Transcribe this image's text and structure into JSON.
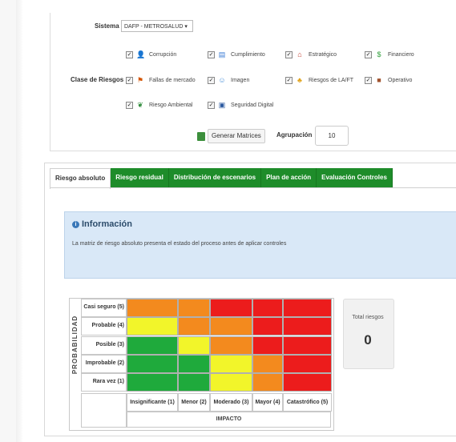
{
  "filters": {
    "system_label": "Sistema",
    "system_value": "DAFP - METROSALUD ▾",
    "risk_class_label": "Clase de Riesgos",
    "risk_classes": [
      {
        "label": "Corrupción",
        "icon": "lock-person-icon",
        "color": "#e88a1a",
        "checked": true
      },
      {
        "label": "Cumplimiento",
        "icon": "clipboard-icon",
        "color": "#3a7bd5",
        "checked": true
      },
      {
        "label": "Estratégico",
        "icon": "house-icon",
        "color": "#c0392b",
        "checked": true
      },
      {
        "label": "Financiero",
        "icon": "dollar-icon",
        "color": "#2e9e3a",
        "checked": true
      },
      {
        "label": "Fallas de mercado",
        "icon": "chart-people-icon",
        "color": "#d35400",
        "checked": true
      },
      {
        "label": "Imagen",
        "icon": "person-icon",
        "color": "#4a90d9",
        "checked": true
      },
      {
        "label": "Riesgos de LA/FT",
        "icon": "money-person-icon",
        "color": "#e0a21a",
        "checked": true
      },
      {
        "label": "Operativo",
        "icon": "briefcase-icon",
        "color": "#a0522d",
        "checked": true
      },
      {
        "label": "Riesgo Ambiental",
        "icon": "leaf-icon",
        "color": "#2e8b3a",
        "checked": true
      },
      {
        "label": "Seguridad Digital",
        "icon": "monitor-icon",
        "color": "#2c5aa0",
        "checked": true
      }
    ],
    "generate_button": "Generar Matrices",
    "grouping_label": "Agrupación",
    "grouping_value": "10"
  },
  "tabs": [
    "Riesgo absoluto",
    "Riesgo residual",
    "Distribución de escenarios",
    "Plan de acción",
    "Evaluación Controles"
  ],
  "active_tab": 0,
  "info": {
    "title": "Información",
    "text": "La matriz de riesgo absoluto presenta el estado del proceso antes de aplicar controles"
  },
  "matrix": {
    "probability_axis": "PROBABILIDAD",
    "impact_axis": "IMPACTO",
    "probability_levels": [
      "Casi seguro (5)",
      "Probable (4)",
      "Posible (3)",
      "Improbable (2)",
      "Rara vez (1)"
    ],
    "impact_levels": [
      "Insignificante (1)",
      "Menor (2)",
      "Moderado (3)",
      "Mayor (4)",
      "Catastrófico (5)"
    ],
    "colors": {
      "green": "#1faa3c",
      "yellow": "#f2f52a",
      "orange": "#f38a1e",
      "red": "#ec1c1c"
    },
    "grid": [
      [
        "orange",
        "orange",
        "red",
        "red",
        "red"
      ],
      [
        "yellow",
        "orange",
        "orange",
        "red",
        "red"
      ],
      [
        "green",
        "yellow",
        "orange",
        "red",
        "red"
      ],
      [
        "green",
        "green",
        "yellow",
        "orange",
        "red"
      ],
      [
        "green",
        "green",
        "yellow",
        "orange",
        "red"
      ]
    ]
  },
  "totals": {
    "label": "Total riesgos",
    "value": "0"
  }
}
